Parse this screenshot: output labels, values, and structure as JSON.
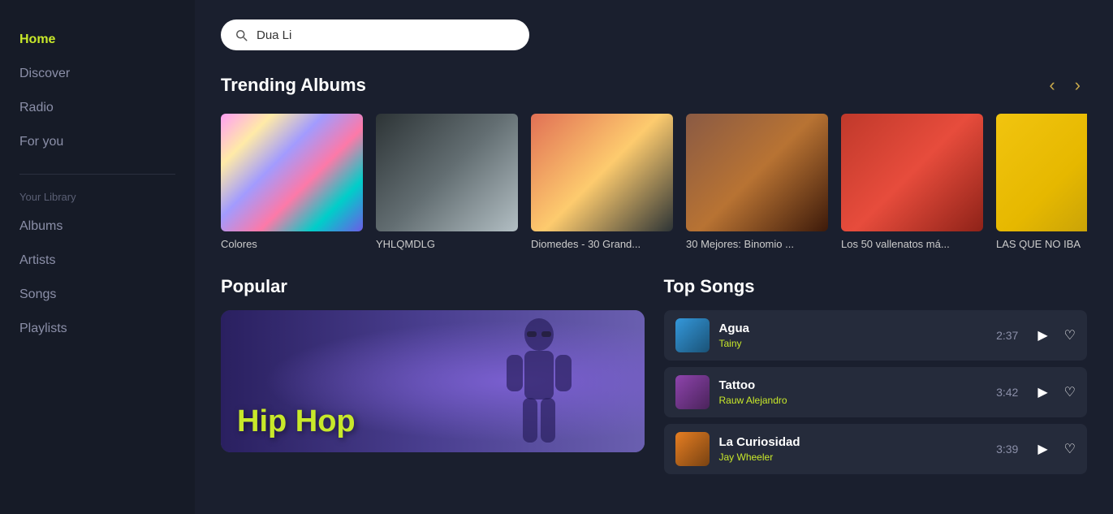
{
  "sidebar": {
    "nav": [
      {
        "label": "Home",
        "active": true,
        "id": "home"
      },
      {
        "label": "Discover",
        "active": false,
        "id": "discover"
      },
      {
        "label": "Radio",
        "active": false,
        "id": "radio"
      },
      {
        "label": "For you",
        "active": false,
        "id": "for-you"
      }
    ],
    "library_label": "Your Library",
    "library_nav": [
      {
        "label": "Albums",
        "id": "albums"
      },
      {
        "label": "Artists",
        "id": "artists"
      },
      {
        "label": "Songs",
        "id": "songs"
      },
      {
        "label": "Playlists",
        "id": "playlists"
      }
    ]
  },
  "search": {
    "placeholder": "Search",
    "value": "Dua Li"
  },
  "trending_albums": {
    "title": "Trending Albums",
    "items": [
      {
        "name": "Colores",
        "color_class": "album-colores"
      },
      {
        "name": "YHLQMDLG",
        "color_class": "album-yhlq"
      },
      {
        "name": "Diomedes - 30 Grand...",
        "color_class": "album-diomedes"
      },
      {
        "name": "30 Mejores: Binomio ...",
        "color_class": "album-30mejores"
      },
      {
        "name": "Los 50 vallenatos má...",
        "color_class": "album-50val"
      },
      {
        "name": "LAS QUE NO IBA",
        "color_class": "album-lasque"
      }
    ]
  },
  "popular": {
    "title": "Popular",
    "banner_label": "Hip Hop"
  },
  "top_songs": {
    "title": "Top Songs",
    "items": [
      {
        "name": "Agua",
        "artist": "Tainy",
        "duration": "2:37",
        "artist_color": "#c8e82a",
        "thumb_class": "thumb-agua"
      },
      {
        "name": "Tattoo",
        "artist": "Rauw Alejandro",
        "duration": "3:42",
        "artist_color": "#c8e82a",
        "thumb_class": "thumb-tattoo"
      },
      {
        "name": "La Curiosidad",
        "artist": "Jay Wheeler",
        "duration": "3:39",
        "artist_color": "#c8e82a",
        "thumb_class": "thumb-curiosidad"
      }
    ]
  },
  "icons": {
    "search": "🔍",
    "play": "▶",
    "heart": "♡",
    "arrow_left": "‹",
    "arrow_right": "›"
  }
}
